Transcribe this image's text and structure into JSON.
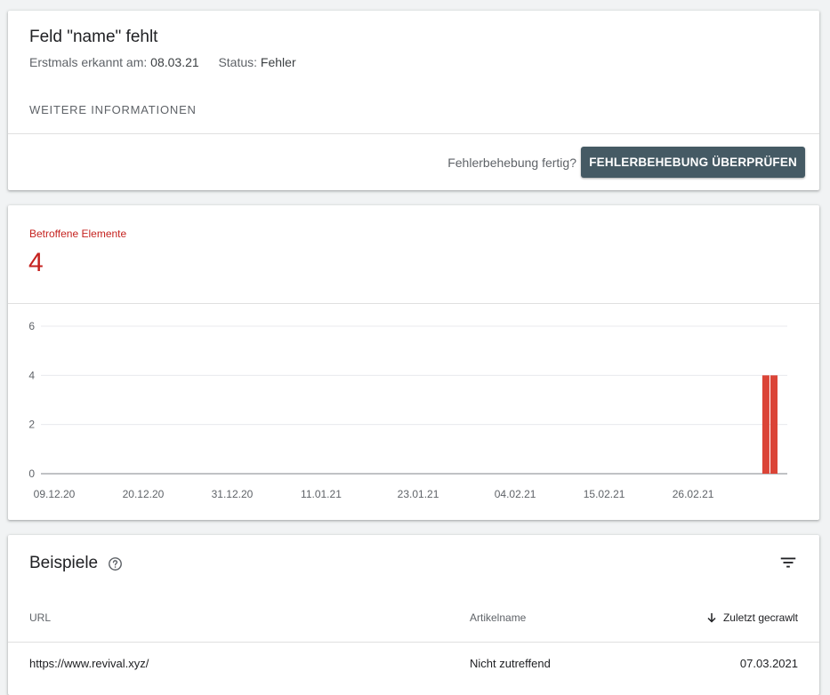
{
  "issue": {
    "title": "Feld \"name\" fehlt",
    "first_detected_label": "Erstmals erkannt am:",
    "first_detected_value": "08.03.21",
    "status_label": "Status:",
    "status_value": "Fehler",
    "more_info_label": "WEITERE INFORMATIONEN",
    "fix_question": "Fehlerbehebung fertig?",
    "fix_button_label": "FEHLERBEHEBUNG ÜBERPRÜFEN"
  },
  "affected": {
    "label": "Betroffene Elemente",
    "count": "4",
    "color": "#c5221f"
  },
  "chart_data": {
    "type": "bar",
    "title": "",
    "xlabel": "",
    "ylabel": "",
    "ylim": [
      0,
      6
    ],
    "y_ticks": [
      "0",
      "2",
      "4",
      "6"
    ],
    "x_ticks": [
      "09.12.20",
      "20.12.20",
      "31.12.20",
      "11.01.21",
      "23.01.21",
      "04.02.21",
      "15.02.21",
      "26.02.21"
    ],
    "x_range": [
      "2020-12-09",
      "2021-03-08"
    ],
    "series": [
      {
        "color": "#db4437",
        "points": [
          {
            "date": "2021-03-07",
            "value": 4
          },
          {
            "date": "2021-03-08",
            "value": 4
          }
        ]
      }
    ],
    "grid": true
  },
  "examples": {
    "title": "Beispiele",
    "help_icon": "help-circle-icon",
    "filter_icon": "filter-icon",
    "columns": {
      "url": "URL",
      "article": "Artikelname",
      "crawled": "Zuletzt gecrawlt"
    },
    "rows": [
      {
        "url": "https://www.revival.xyz/",
        "article": "Nicht zutreffend",
        "crawled": "07.03.2021"
      }
    ]
  }
}
